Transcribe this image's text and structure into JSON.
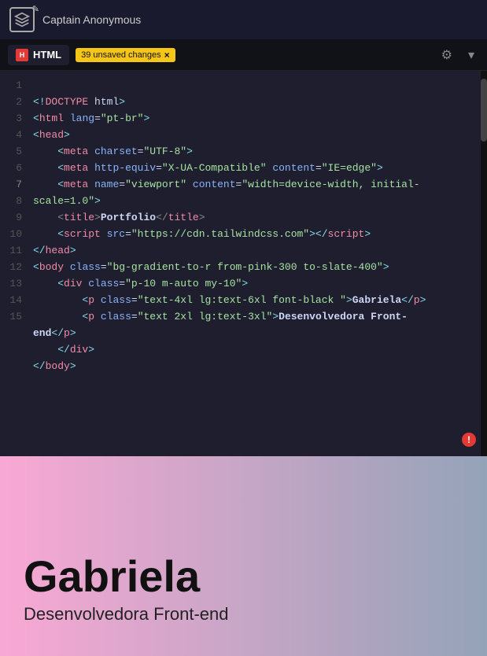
{
  "app": {
    "title": "Captain Anonymous",
    "logo_alt": "logo"
  },
  "tab_bar": {
    "tab_label": "HTML",
    "tab_dot": "H",
    "unsaved_badge": "39 unsaved changes",
    "unsaved_x": "×",
    "gear_icon": "⚙",
    "chevron_icon": "▾"
  },
  "editor": {
    "lines": [
      {
        "num": 1,
        "content": "html_doctype"
      },
      {
        "num": 2,
        "content": "html_lang"
      },
      {
        "num": 3,
        "content": "head_open"
      },
      {
        "num": 4,
        "content": "meta_charset"
      },
      {
        "num": 5,
        "content": "meta_http"
      },
      {
        "num": 6,
        "content": "meta_viewport"
      },
      {
        "num": 7,
        "content": "title_portfolio"
      },
      {
        "num": 8,
        "content": "script_tailwind"
      },
      {
        "num": 9,
        "content": "head_close"
      },
      {
        "num": 10,
        "content": "body_class"
      },
      {
        "num": 11,
        "content": "div_class"
      },
      {
        "num": 12,
        "content": "p_gabriela"
      },
      {
        "num": 13,
        "content": "p_desenvolvedora"
      },
      {
        "num": 14,
        "content": "div_close"
      },
      {
        "num": 15,
        "content": "body_close"
      }
    ]
  },
  "error_icon": "!",
  "preview": {
    "name": "Gabriela",
    "subtitle": "Desenvolvedora Front-end"
  }
}
